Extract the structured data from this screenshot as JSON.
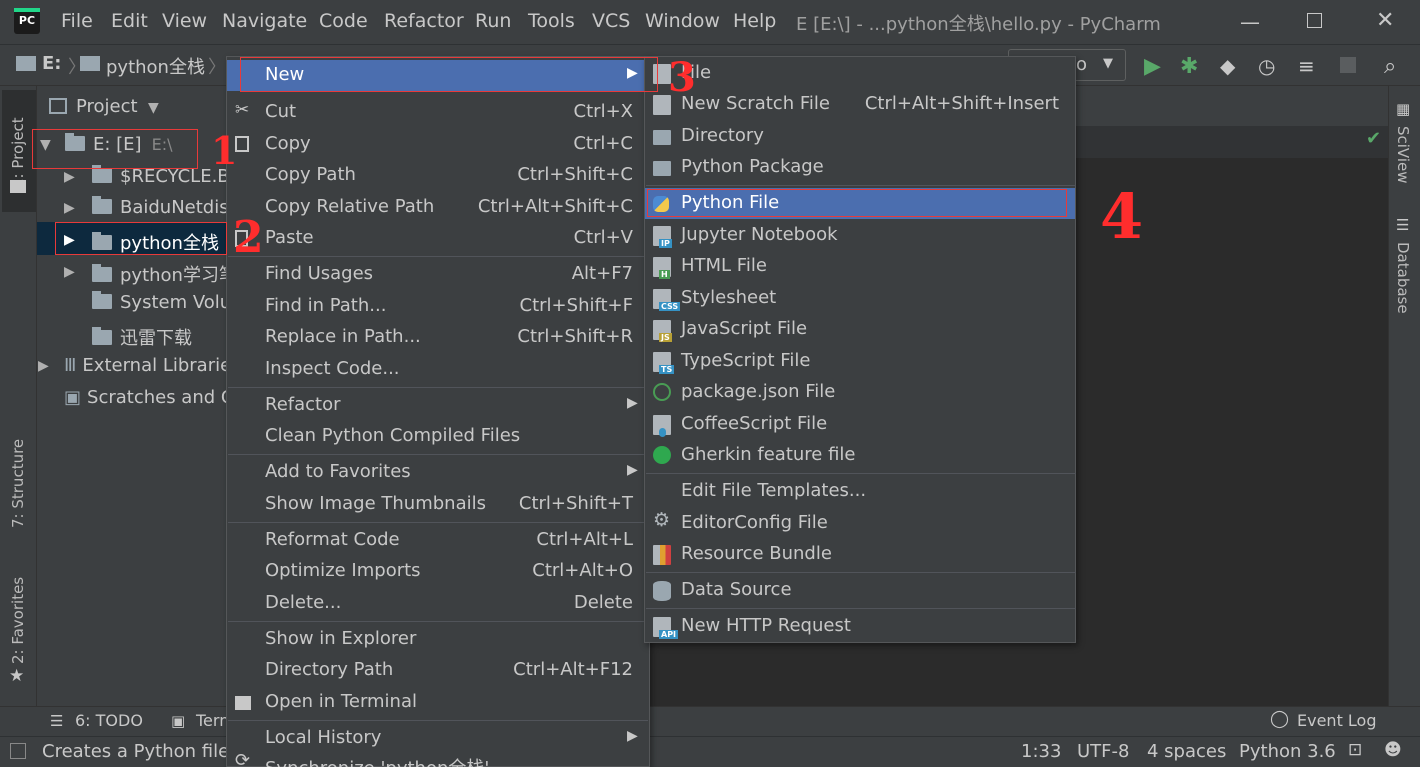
{
  "menubar": {
    "items": [
      "File",
      "Edit",
      "View",
      "Navigate",
      "Code",
      "Refactor",
      "Run",
      "Tools",
      "VCS",
      "Window",
      "Help"
    ],
    "title": "E [E:\\] - ...python全栈\\hello.py - PyCharm"
  },
  "breadcrumb": {
    "drive": "E:",
    "folder": "python全栈",
    "run_config": "lo"
  },
  "project": {
    "header": "Project",
    "tab_project": "1: Project",
    "tab_structure": "7: Structure",
    "tab_favorites": "2: Favorites",
    "root": "E: [E]",
    "root_path": "E:\\",
    "items": [
      "$RECYCLE.BI",
      "BaiduNetdis",
      "python全栈",
      "python学习笔",
      "System Volu",
      "迅雷下载"
    ],
    "external": "External Librarie",
    "scratches": "Scratches and C"
  },
  "right_tabs": {
    "sciview": "SciView",
    "database": "Database"
  },
  "context_menu": {
    "new": "New",
    "cut": "Cut",
    "cut_sc": "Ctrl+X",
    "copy": "Copy",
    "copy_sc": "Ctrl+C",
    "copy_path": "Copy Path",
    "copy_path_sc": "Ctrl+Shift+C",
    "copy_rel": "Copy Relative Path",
    "copy_rel_sc": "Ctrl+Alt+Shift+C",
    "paste": "Paste",
    "paste_sc": "Ctrl+V",
    "find_usages": "Find Usages",
    "find_usages_sc": "Alt+F7",
    "find_in_path": "Find in Path...",
    "find_in_path_sc": "Ctrl+Shift+F",
    "replace_in_path": "Replace in Path...",
    "replace_in_path_sc": "Ctrl+Shift+R",
    "inspect": "Inspect Code...",
    "refactor": "Refactor",
    "clean": "Clean Python Compiled Files",
    "add_fav": "Add to Favorites",
    "thumbs": "Show Image Thumbnails",
    "thumbs_sc": "Ctrl+Shift+T",
    "reformat": "Reformat Code",
    "reformat_sc": "Ctrl+Alt+L",
    "optimize": "Optimize Imports",
    "optimize_sc": "Ctrl+Alt+O",
    "delete": "Delete...",
    "delete_sc": "Delete",
    "explorer": "Show in Explorer",
    "dirpath": "Directory Path",
    "dirpath_sc": "Ctrl+Alt+F12",
    "terminal": "Open in Terminal",
    "history": "Local History",
    "sync": "Synchronize 'python全栈'"
  },
  "submenu": {
    "file": "File",
    "scratch": "New Scratch File",
    "scratch_sc": "Ctrl+Alt+Shift+Insert",
    "directory": "Directory",
    "pypkg": "Python Package",
    "pyfile": "Python File",
    "jupyter": "Jupyter Notebook",
    "html": "HTML File",
    "stylesheet": "Stylesheet",
    "js": "JavaScript File",
    "ts": "TypeScript File",
    "pkgjson": "package.json File",
    "coffee": "CoffeeScript File",
    "gherkin": "Gherkin feature file",
    "templates": "Edit File Templates...",
    "editorconfig": "EditorConfig File",
    "resource": "Resource Bundle",
    "datasource": "Data Source",
    "http": "New HTTP Request"
  },
  "bottom": {
    "todo": "6: TODO",
    "terminal": "Term",
    "event_log": "Event Log"
  },
  "status": {
    "message": "Creates a Python file f",
    "position": "1:33",
    "encoding": "UTF-8",
    "indent": "4 spaces",
    "interpreter": "Python 3.6"
  },
  "annotations": [
    "1",
    "2",
    "3",
    "4"
  ],
  "colors": {
    "selection": "#4b6eaf",
    "annotation": "#ff2d2d",
    "panel": "#3c3f41",
    "editor": "#2b2b2b"
  }
}
